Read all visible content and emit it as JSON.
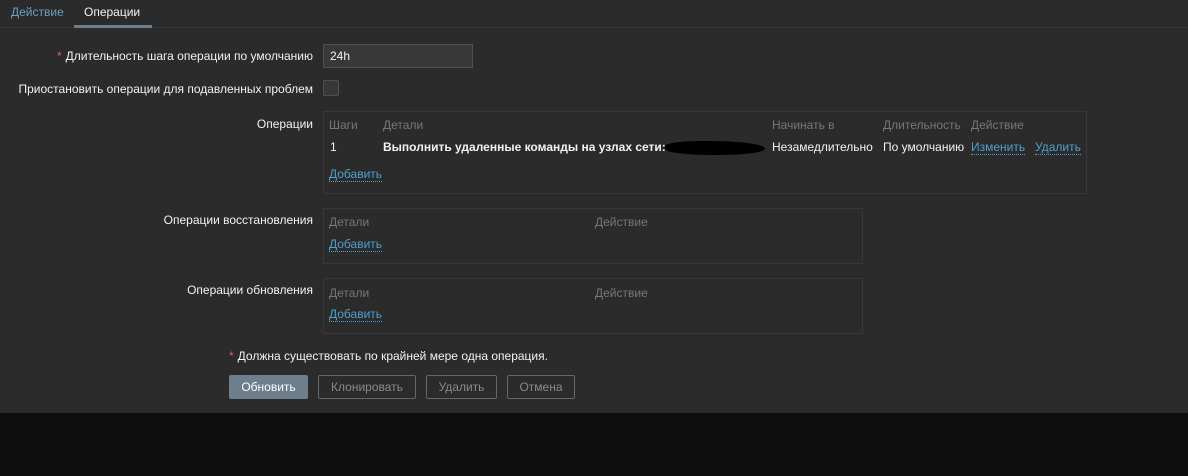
{
  "tabs": [
    {
      "label": "Действие",
      "active": false
    },
    {
      "label": "Операции",
      "active": true
    }
  ],
  "form": {
    "step_duration_label": "Длительность шага операции по умолчанию",
    "step_duration_value": "24h",
    "pause_label": "Приостановить операции для подавленных проблем",
    "pause_checked": false,
    "operations": {
      "label": "Операции",
      "headers": [
        "Шаги",
        "Детали",
        "Начинать в",
        "Длительность",
        "Действие"
      ],
      "rows": [
        {
          "step": "1",
          "details": "Выполнить удаленные команды на узлах сети:",
          "start": "Незамедлительно",
          "duration": "По умолчанию",
          "edit": "Изменить",
          "delete": "Удалить"
        }
      ],
      "add": "Добавить"
    },
    "recovery": {
      "label": "Операции восстановления",
      "headers": [
        "Детали",
        "Действие"
      ],
      "add": "Добавить"
    },
    "update": {
      "label": "Операции обновления",
      "headers": [
        "Детали",
        "Действие"
      ],
      "add": "Добавить"
    },
    "note": "Должна существовать по крайней мере одна операция.",
    "required_mark": "*"
  },
  "buttons": {
    "update": "Обновить",
    "clone": "Клонировать",
    "delete": "Удалить",
    "cancel": "Отмена"
  },
  "colors": {
    "accent": "#4f9fd0",
    "required": "#e45959",
    "primary_button": "#6d7f8c",
    "background": "#2b2b2b"
  }
}
